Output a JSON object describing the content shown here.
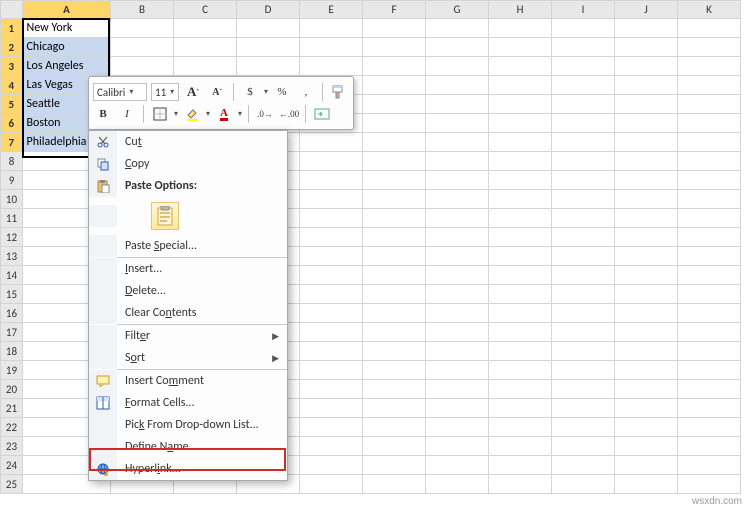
{
  "columns": [
    "A",
    "B",
    "C",
    "D",
    "E",
    "F",
    "G",
    "H",
    "I",
    "J",
    "K"
  ],
  "rows": 25,
  "cells": {
    "A1": "New York",
    "A2": "Chicago",
    "A3": "Los Angeles",
    "A4": "Las Vegas",
    "A5": "Seattle",
    "A6": "Boston",
    "A7": "Philadelphia"
  },
  "selection": {
    "col": "A",
    "rowStart": 1,
    "rowEnd": 7
  },
  "minitoolbar": {
    "font": "Calibri",
    "size": "11",
    "growA": "A",
    "shrinkA": "A",
    "dollar": "$",
    "percent": "%",
    "comma": ",",
    "bold": "B",
    "italic": "I"
  },
  "context": {
    "cut": "Cut",
    "copy": "Copy",
    "pasteOptionsTitle": "Paste Options:",
    "pasteSpecial": "Paste Special...",
    "insert": "Insert...",
    "delete": "Delete...",
    "clear": "Clear Contents",
    "filter": "Filter",
    "sort": "Sort",
    "insertComment": "Insert Comment",
    "formatCells": "Format Cells...",
    "pickList": "Pick From Drop-down List...",
    "defineName": "Define Name...",
    "hyperlink": "Hyperlink..."
  },
  "watermark": "wsxdn.com"
}
